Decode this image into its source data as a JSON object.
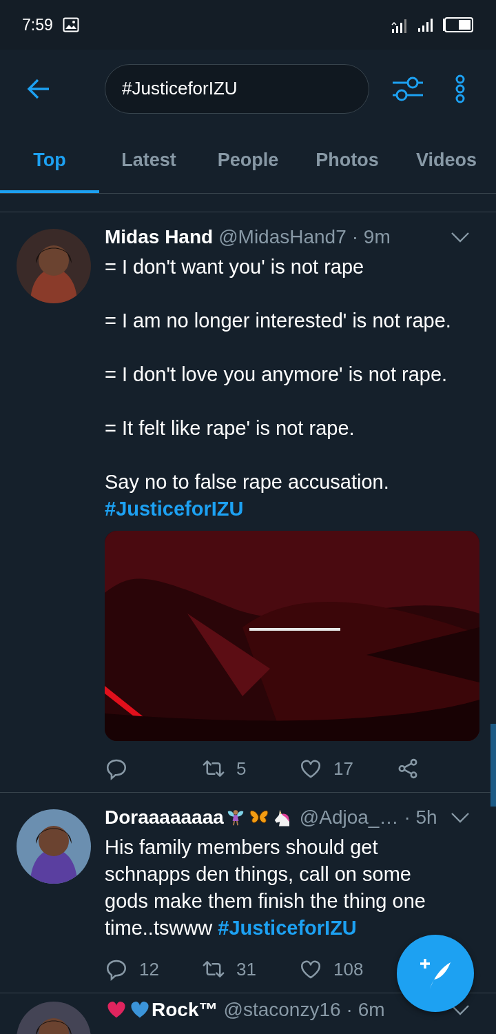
{
  "status_bar": {
    "time": "7:59"
  },
  "search": {
    "value": "#JusticeforIZU"
  },
  "tabs": [
    {
      "label": "Top",
      "selected": true
    },
    {
      "label": "Latest",
      "selected": false
    },
    {
      "label": "People",
      "selected": false
    },
    {
      "label": "Photos",
      "selected": false
    },
    {
      "label": "Videos",
      "selected": false
    }
  ],
  "tweets": [
    {
      "name": "Midas Hand",
      "handle": "@MidasHand7",
      "time": "· 9m",
      "paragraphs": [
        [
          [
            {
              "kind": "text",
              "text": "= I don't want you' is not rape"
            }
          ]
        ],
        [
          [
            {
              "kind": "text",
              "text": "= I am no longer interested' is not rape."
            }
          ]
        ],
        [
          [
            {
              "kind": "text",
              "text": "= I don't love you anymore' is not rape."
            }
          ]
        ],
        [
          [
            {
              "kind": "text",
              "text": "= It felt like rape' is not rape."
            }
          ]
        ],
        [
          [
            {
              "kind": "text",
              "text": "Say no to false rape accusation."
            }
          ],
          [
            {
              "kind": "hashtag",
              "text": "#JusticeforIZU"
            }
          ]
        ]
      ],
      "media": {
        "kind": "picture"
      },
      "actions": [
        {
          "kind": "reply"
        },
        {
          "kind": "retweet",
          "count": "5"
        },
        {
          "kind": "like",
          "count": "17"
        },
        {
          "kind": "share"
        }
      ]
    },
    {
      "name": "Doraaaaaaaa",
      "name_suffix_icons": [
        {
          "kind": "fairy"
        },
        {
          "kind": "butterfly"
        },
        {
          "kind": "unicorn"
        }
      ],
      "handle": "@Adjoa_…",
      "time": "· 5h",
      "paragraphs": [
        [
          [
            {
              "kind": "text",
              "text": "His family members should get schnapps den things, call on some gods make them finish the thing one time..tswww "
            },
            {
              "kind": "hashtag",
              "text": "#JusticeforIZU"
            }
          ]
        ]
      ],
      "actions": [
        {
          "kind": "reply",
          "count": "12"
        },
        {
          "kind": "retweet",
          "count": "31"
        },
        {
          "kind": "like",
          "count": "108"
        }
      ]
    },
    {
      "name": "Rock™",
      "name_prefix_icons": [
        {
          "kind": "heart",
          "color": "#e0245e"
        },
        {
          "kind": "heart",
          "color": "#3b94d9"
        }
      ],
      "handle": "@staconzy16",
      "time": "· 6m"
    }
  ]
}
